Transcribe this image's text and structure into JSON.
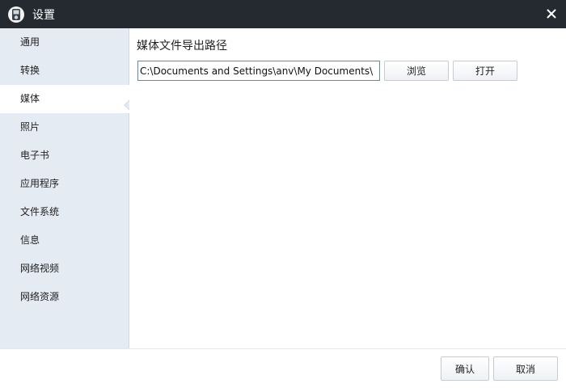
{
  "window": {
    "title": "设置",
    "app_icon": "player-app-icon",
    "close_icon": "close-icon"
  },
  "sidebar": {
    "items": [
      {
        "label": "通用"
      },
      {
        "label": "转换"
      },
      {
        "label": "媒体",
        "active": true
      },
      {
        "label": "照片"
      },
      {
        "label": "电子书"
      },
      {
        "label": "应用程序"
      },
      {
        "label": "文件系统"
      },
      {
        "label": "信息"
      },
      {
        "label": "网络视频"
      },
      {
        "label": "网络资源"
      }
    ]
  },
  "media": {
    "section_title": "媒体文件导出路径",
    "path_value": "C:\\Documents and Settings\\anv\\My Documents\\",
    "browse_label": "浏览",
    "open_label": "打开"
  },
  "footer": {
    "confirm_label": "确认",
    "cancel_label": "取消"
  },
  "colors": {
    "titlebar": "#252a31",
    "sidebar": "#e4ebf3",
    "input_border": "#4f90c6"
  }
}
